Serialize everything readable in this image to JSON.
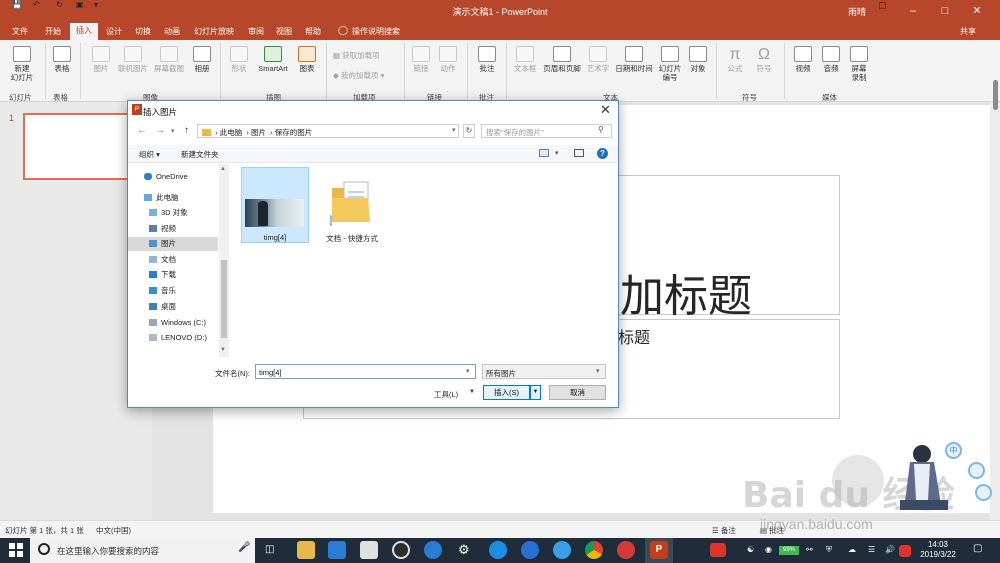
{
  "app": {
    "document_title": "演示文稿1",
    "app_name": "PowerPoint",
    "title_separator": " - ",
    "user_name": "雨晴",
    "share_label": "共享"
  },
  "tabs": [
    "文件",
    "开始",
    "插入",
    "设计",
    "切换",
    "动画",
    "幻灯片放映",
    "审阅",
    "视图",
    "帮助"
  ],
  "tell_me": "操作说明搜索",
  "ribbon": {
    "new_slide": "新建\n幻灯片",
    "table": "表格",
    "picture": "图片",
    "online_picture": "联机图片",
    "screenshot": "屏幕截图",
    "album": "相册",
    "shapes": "形状",
    "smartart": "SmartArt",
    "chart": "图表",
    "get_addins": "获取加载项",
    "my_addins": "我的加载项",
    "link": "链接",
    "action": "动作",
    "comment": "批注",
    "textbox": "文本框",
    "header_footer": "页眉和页脚",
    "wordart": "艺术字",
    "date_time": "日期和时间",
    "slide_number": "幻灯片\n编号",
    "object": "对象",
    "equation": "公式",
    "symbol": "符号",
    "video": "视频",
    "audio": "音频",
    "screen_record": "屏幕\n录制",
    "groups": {
      "slides": "幻灯片",
      "tables": "表格",
      "images": "图像",
      "illustrations": "插图",
      "addins": "加载项",
      "links": "链接",
      "comments": "批注",
      "text": "文本",
      "symbols": "符号",
      "media": "媒体"
    }
  },
  "slide_panel": {
    "slide_number": "1"
  },
  "slide": {
    "title_placeholder": "加标题",
    "subtitle_placeholder": "标题"
  },
  "dialog": {
    "title": "插入图片",
    "address": [
      "此电脑",
      "图片",
      "保存的图片"
    ],
    "search_placeholder": "搜索\"保存的图片\"",
    "organize": "组织",
    "new_folder": "新建文件夹",
    "nav_items": [
      "OneDrive",
      "此电脑",
      "3D 对象",
      "视频",
      "图片",
      "文档",
      "下载",
      "音乐",
      "桌面",
      "Windows (C:)",
      "LENOVO (D:)"
    ],
    "selected_nav": "图片",
    "files": [
      {
        "name": "timg[4]",
        "selected": true
      },
      {
        "name": "文档 - 快捷方式",
        "selected": false
      }
    ],
    "filename_label": "文件名(N):",
    "filename_value": "timg[4]",
    "filetype": "所有图片",
    "tools": "工具(L)",
    "insert": "插入(S)",
    "cancel": "取消"
  },
  "status": {
    "slide_info": "幻灯片 第 1 张，共 1 张",
    "language": "中文(中国)",
    "notes": "备注",
    "comments": "批注"
  },
  "taskbar": {
    "search_placeholder": "在这里输入你要搜索的内容",
    "battery": "99%",
    "time": "14:03",
    "date": "2019/3/22"
  },
  "watermark": {
    "text": "Bai du 经验",
    "url": "jingyan.baidu.com",
    "bubble": "中"
  },
  "colors": {
    "accent": "#b7472a",
    "ribbon_bg": "#f3f3f3",
    "selection": "#cce8ff",
    "taskbar": "#1f2d3a"
  }
}
